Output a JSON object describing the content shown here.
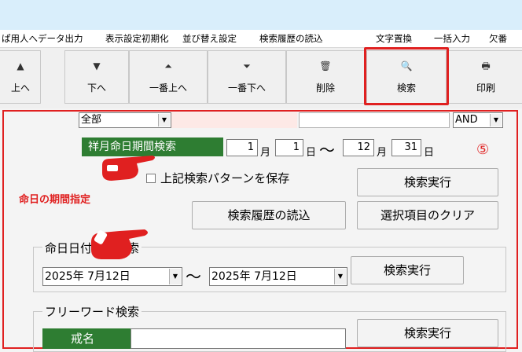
{
  "menu": {
    "items": [
      "ぱ用人へデータ出力",
      "表示設定初期化",
      "並び替え設定",
      "検索履歴の読込",
      "文字置換",
      "一括入力",
      "欠番"
    ]
  },
  "toolbar": {
    "buttons": [
      {
        "label": "上へ",
        "icon": "▲"
      },
      {
        "label": "下へ",
        "icon": "▼"
      },
      {
        "label": "一番上へ",
        "icon": "⏶"
      },
      {
        "label": "一番下へ",
        "icon": "⏷"
      },
      {
        "label": "削除",
        "icon": "🗑"
      },
      {
        "label": "検索",
        "icon": "🔍"
      },
      {
        "label": "印刷",
        "icon": "🖶"
      }
    ]
  },
  "top_row": {
    "combo1_value": "全部",
    "combo2_value": "AND"
  },
  "period_search": {
    "label": "祥月命日期間検索",
    "start_month": "1",
    "start_day": "1",
    "end_month": "12",
    "end_day": "31",
    "month_unit": "月",
    "day_unit": "日",
    "tilde": "～",
    "badge": "⑤"
  },
  "save_pattern": {
    "label": "上記検索パターンを保存",
    "checked": false
  },
  "buttons": {
    "search_exec": "検索実行",
    "history_load": "検索履歴の読込",
    "clear_selection": "選択項目のクリア"
  },
  "annotation": {
    "text": "命日の期間指定"
  },
  "date_search": {
    "title": "命日日付範囲検索",
    "from": "2025年 7月12日",
    "to": "2025年 7月12日",
    "tilde": "～",
    "button": "検索実行"
  },
  "free_word": {
    "title": "フリーワード検索",
    "field_label": "戒名",
    "value": "",
    "button": "検索実行"
  },
  "colors": {
    "accent_red": "#e02020",
    "label_green": "#2e7d32",
    "title_strip": "#d9eefb"
  }
}
